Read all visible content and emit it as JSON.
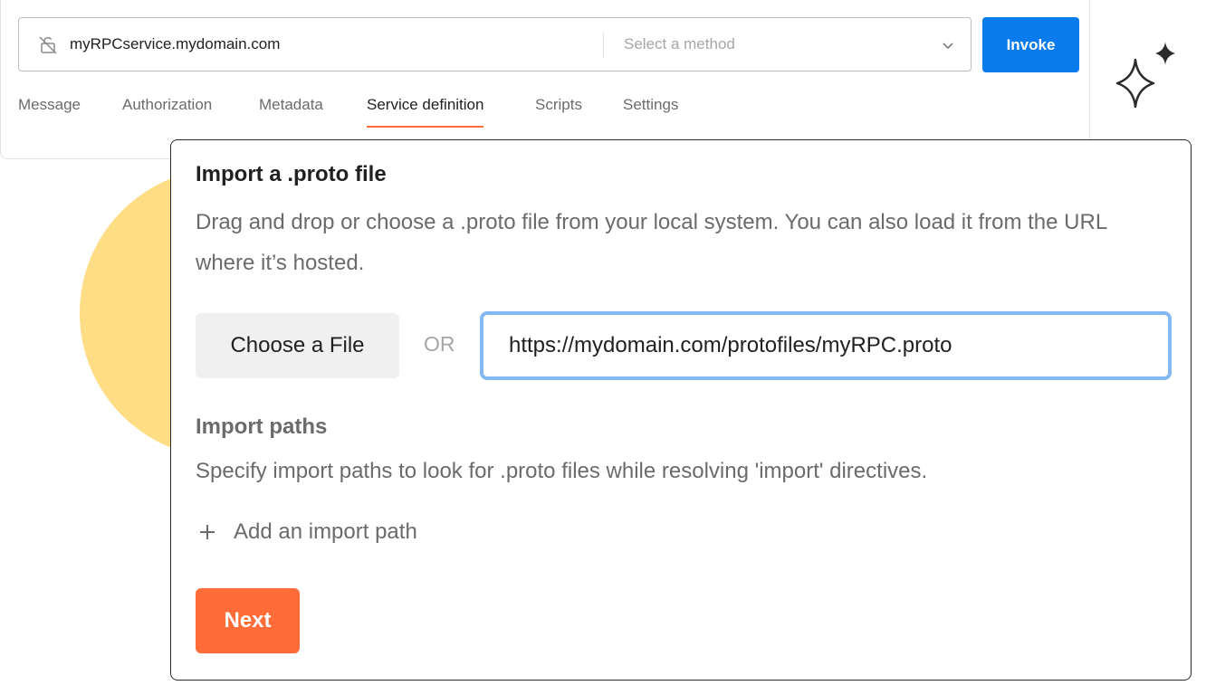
{
  "request": {
    "url": "myRPCservice.mydomain.com",
    "method_placeholder": "Select a method",
    "invoke_label": "Invoke"
  },
  "tabs": [
    {
      "label": "Message",
      "active": false
    },
    {
      "label": "Authorization",
      "active": false
    },
    {
      "label": "Metadata",
      "active": false
    },
    {
      "label": "Service definition",
      "active": true
    },
    {
      "label": "Scripts",
      "active": false
    },
    {
      "label": "Settings",
      "active": false
    }
  ],
  "import_dialog": {
    "title": "Import a .proto file",
    "description": "Drag and drop or choose a .proto file from your local system. You can also load it from the URL where it’s hosted.",
    "choose_file_label": "Choose a File",
    "or_label": "OR",
    "proto_url_value": "https://mydomain.com/protofiles/myRPC.proto",
    "import_paths_title": "Import paths",
    "import_paths_description": "Specify import paths to look for .proto files while resolving 'import' directives.",
    "add_import_path_label": "Add an import path",
    "next_label": "Next"
  },
  "icons": {
    "url_bar": "unlocked-icon",
    "method_dropdown": "chevron-down-icon",
    "decoration": "sparkle-icon",
    "add_path": "plus-icon"
  },
  "colors": {
    "invoke_button": "#097BED",
    "next_button": "#FF6C37",
    "active_tab_underline": "#FF6C37",
    "input_focus_border": "#84B8F2",
    "decorative_circle": "#FFDD85"
  }
}
